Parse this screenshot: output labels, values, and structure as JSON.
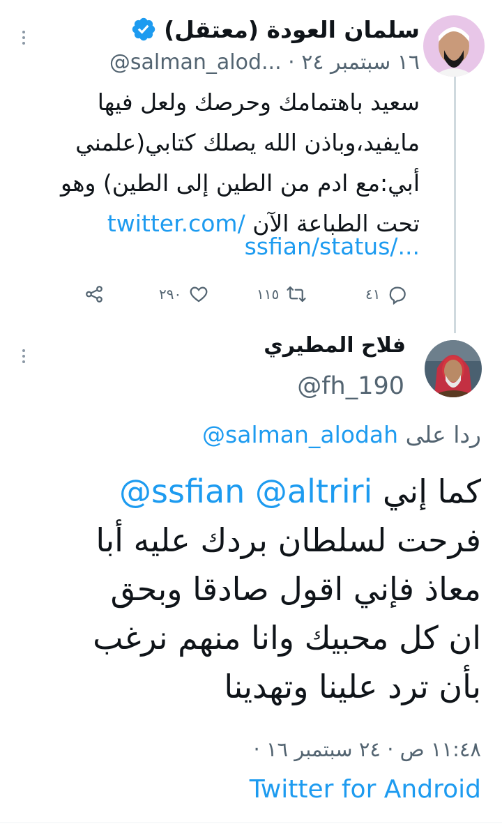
{
  "tweet1": {
    "author_name": "سلمان العودة (معتقل)",
    "handle": "@salman_alod...",
    "separator": "·",
    "date": "١٦ سبتمبر ٢٤",
    "text_lines": [
      "سعيد باهتمامك وحرصك ولعل فيها",
      "مايفيد،وباذن الله يصلك كتابي(علمني",
      "أبي:مع ادم من الطين إلى الطين) وهو",
      "تحت الطباعة الآن"
    ],
    "link_line1": "twitter.com/",
    "link_line2": "ssfian/status/...",
    "actions": {
      "reply_count": "٤١",
      "retweet_count": "١١٥",
      "like_count": "٢٩٠"
    },
    "icons": [
      "verified-badge-icon",
      "reply-icon",
      "retweet-icon",
      "like-icon",
      "share-icon",
      "more-icon"
    ]
  },
  "tweet2": {
    "author_name": "فلاح المطيري",
    "handle": "@fh_190",
    "reply_prefix": "ردا على",
    "reply_to_handle": "@salman_alodah",
    "mentions": "@ssfian @altriri",
    "text_first": "كما إني",
    "text_lines": [
      "فرحت لسلطان بردك عليه أبا",
      "معاذ فإني اقول صادقا وبحق",
      "ان كل محبيك وانا منهم نرغب",
      "بأن ترد علينا وتهدينا"
    ],
    "timestamp": "١١:٤٨ ص · ٢٤ سبتمبر ١٦ ·",
    "source": "Twitter for Android"
  },
  "colors": {
    "text": "#0f1419",
    "secondary": "#536471",
    "link": "#1d9bf0",
    "verified": "#1d9bf0",
    "thread_line": "#cfd9de"
  }
}
